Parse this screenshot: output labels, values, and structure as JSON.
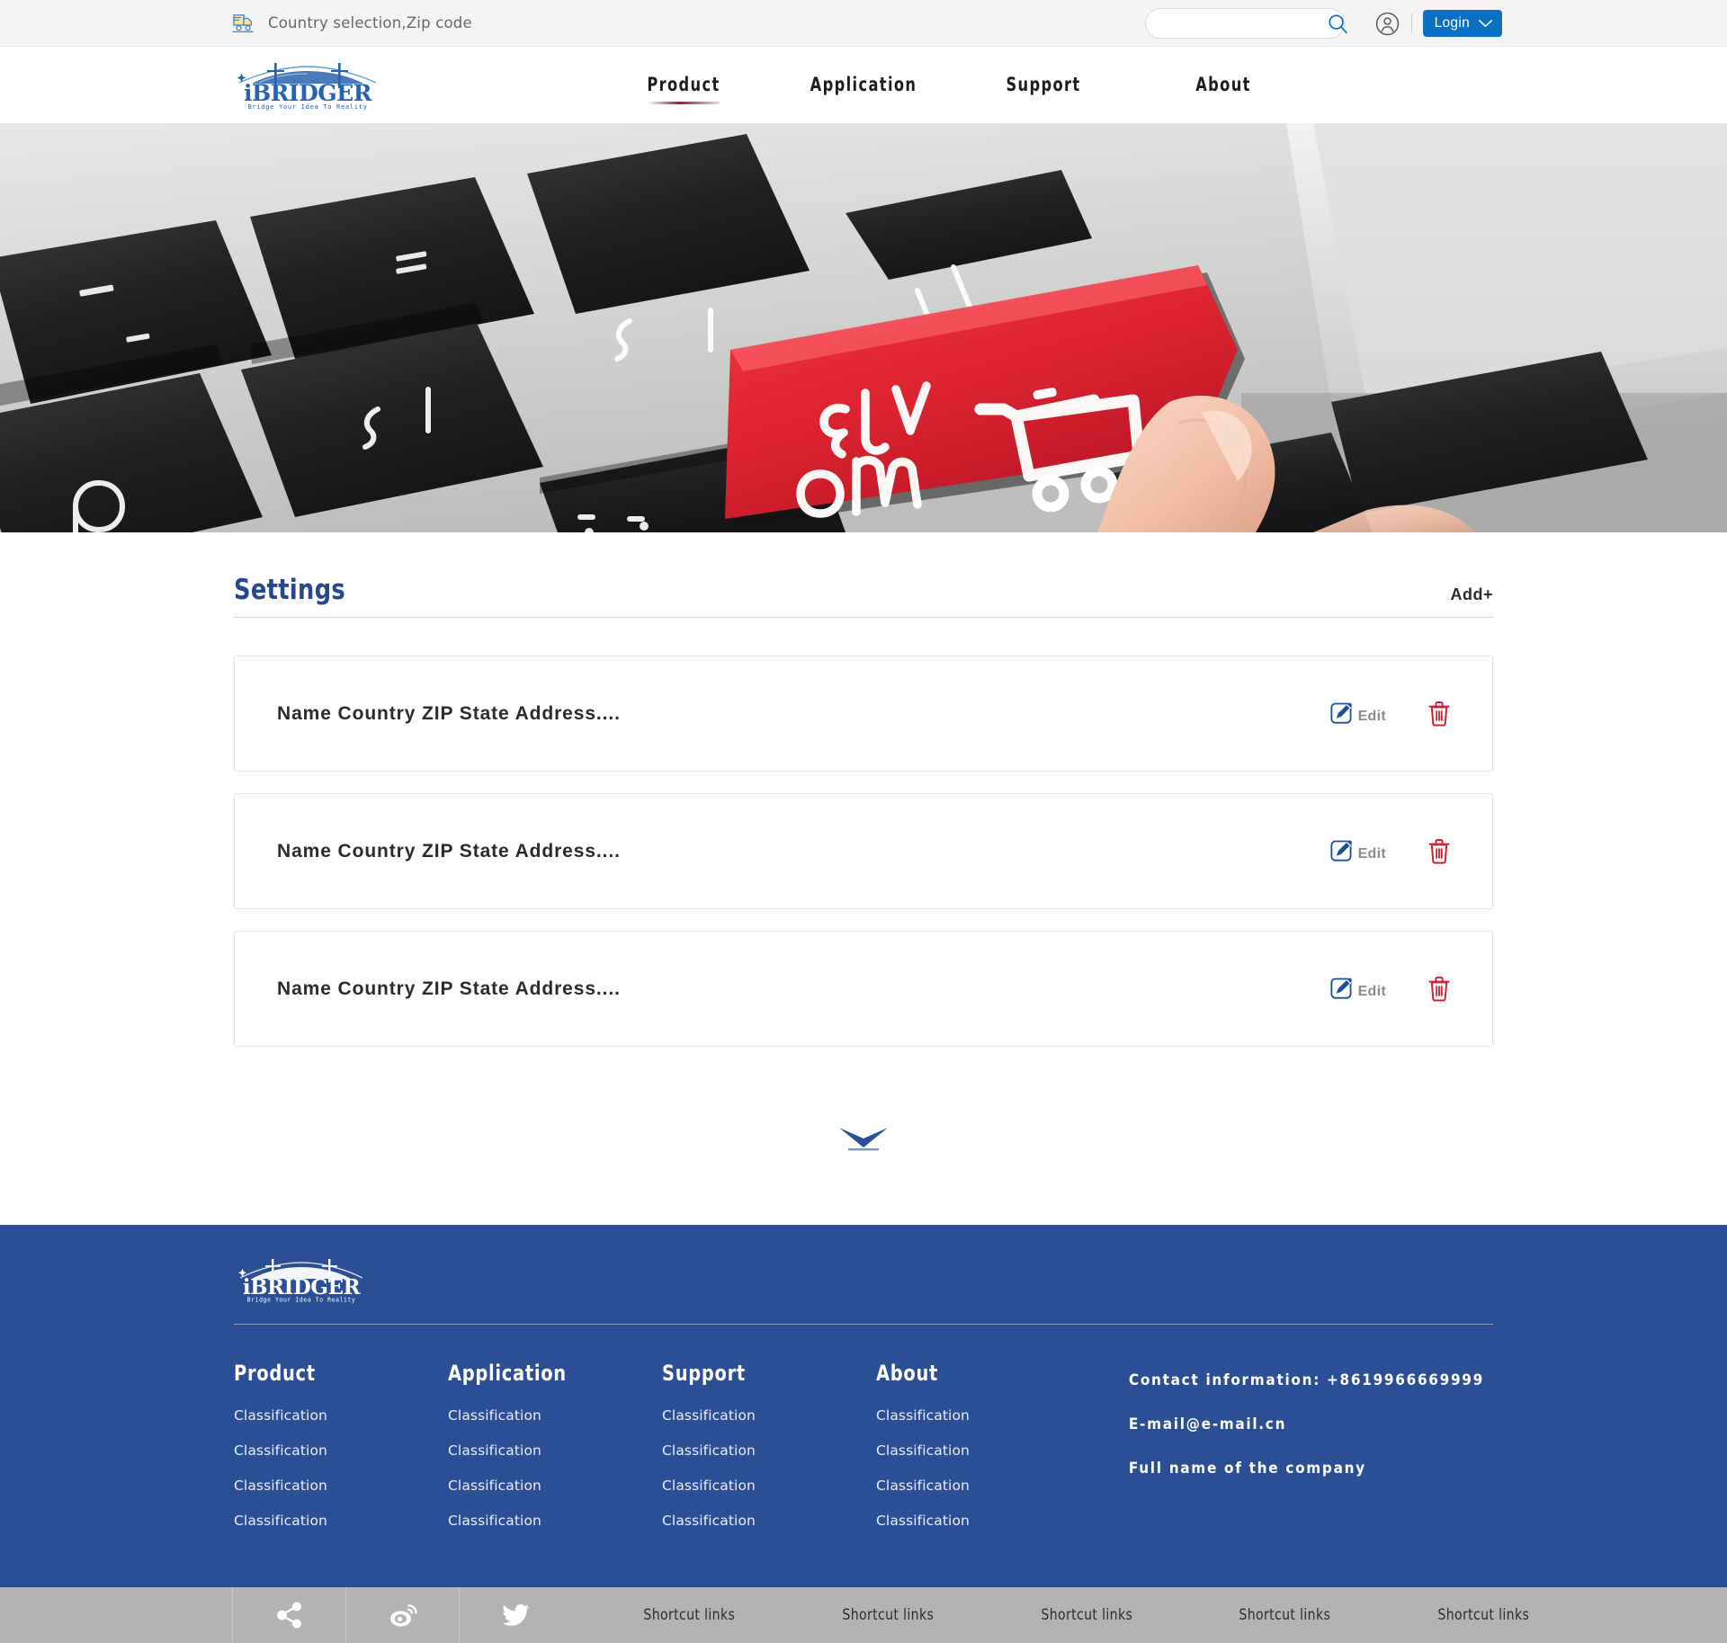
{
  "topbar": {
    "shipping_icon": "delivery-truck-icon",
    "shipping_text": "Country selection,Zip code",
    "search": {
      "value": "",
      "placeholder": "",
      "icon": "search-icon"
    },
    "account_icon": "user-account-icon",
    "login_label": "Login",
    "login_chevron": "chevron-down-icon",
    "colors": {
      "login_bg": "#0b6fc4",
      "bar_bg": "#f4f4f4"
    }
  },
  "brand": {
    "name": "iBRIDGER",
    "tagline": "Bridge Your Idea To Reality",
    "logo_icon": "bridge-logo-icon"
  },
  "nav": {
    "items": [
      {
        "label": "Product",
        "active": true
      },
      {
        "label": "Application",
        "active": false
      },
      {
        "label": "Support",
        "active": false
      },
      {
        "label": "About",
        "active": false
      }
    ],
    "active_underline_color": "#9e1b32"
  },
  "hero": {
    "alt": "laptop keyboard with red buy now key being pressed by a finger",
    "key_label_line1": "BUY",
    "key_label_line2": "NOW",
    "cart_icon": "shopping-cart-icon",
    "key_color": "#dc2330"
  },
  "main": {
    "title": "Settings",
    "title_color": "#26478d",
    "add_label": "Add+",
    "rows": [
      {
        "text": "Name Country ZIP State Address....",
        "edit_label": "Edit",
        "edit_icon": "edit-pencil-icon",
        "delete_icon": "trash-icon"
      },
      {
        "text": "Name Country ZIP State Address....",
        "edit_label": "Edit",
        "edit_icon": "edit-pencil-icon",
        "delete_icon": "trash-icon"
      },
      {
        "text": "Name Country ZIP State Address....",
        "edit_label": "Edit",
        "edit_icon": "edit-pencil-icon",
        "delete_icon": "trash-icon"
      }
    ],
    "load_more_icon": "chevron-down-icon"
  },
  "footer": {
    "bg_color": "#2a4f94",
    "logo_icon": "bridge-logo-icon",
    "columns": [
      {
        "title": "Product",
        "links": [
          "Classification",
          "Classification",
          "Classification",
          "Classification"
        ]
      },
      {
        "title": "Application",
        "links": [
          "Classification",
          "Classification",
          "Classification",
          "Classification"
        ]
      },
      {
        "title": "Support",
        "links": [
          "Classification",
          "Classification",
          "Classification",
          "Classification"
        ]
      },
      {
        "title": "About",
        "links": [
          "Classification",
          "Classification",
          "Classification",
          "Classification"
        ]
      }
    ],
    "contact": {
      "phone_line": "Contact information: +8619966669999",
      "email_line": "E-mail@e-mail.cn",
      "company_line": "Full name of the company"
    }
  },
  "bottombar": {
    "bg_color": "#b3b3b3",
    "social": [
      {
        "name": "share-icon"
      },
      {
        "name": "weibo-icon"
      },
      {
        "name": "twitter-icon"
      }
    ],
    "shortcuts": [
      "Shortcut links",
      "Shortcut links",
      "Shortcut links",
      "Shortcut links",
      "Shortcut links"
    ]
  }
}
